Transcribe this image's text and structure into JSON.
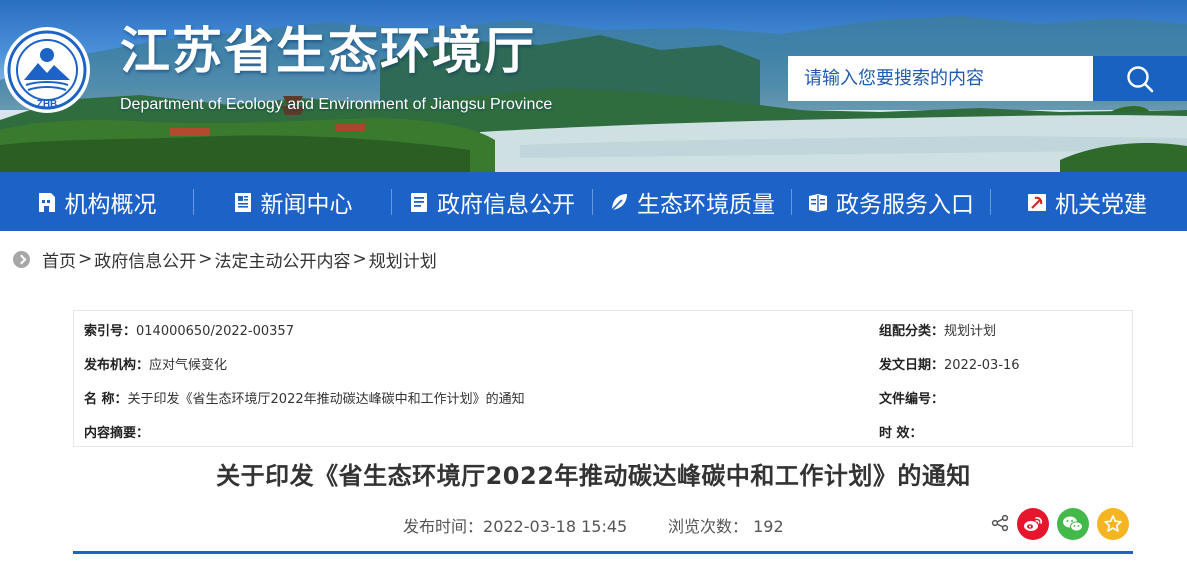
{
  "header": {
    "title": "江苏省生态环境厅",
    "subtitle": "Department of Ecology and Environment of Jiangsu Province",
    "logo_text": "ZHB",
    "search": {
      "placeholder": "请输入您要搜索的内容"
    },
    "colors": {
      "brand": "#1d62c6"
    }
  },
  "nav": {
    "items": [
      {
        "label": "机构概况",
        "icon": "building-icon"
      },
      {
        "label": "新闻中心",
        "icon": "news-icon"
      },
      {
        "label": "政府信息公开",
        "icon": "document-icon"
      },
      {
        "label": "生态环境质量",
        "icon": "leaf-icon"
      },
      {
        "label": "政务服务入口",
        "icon": "service-icon"
      },
      {
        "label": "机关党建",
        "icon": "party-icon"
      }
    ]
  },
  "breadcrumb": {
    "items": [
      "首页",
      "政府信息公开",
      "法定主动公开内容",
      "规划计划"
    ],
    "separator": ">"
  },
  "meta": {
    "index_label": "索引号：",
    "index_value": "014000650/2022-00357",
    "category_label": "组配分类：",
    "category_value": "规划计划",
    "publisher_label": "发布机构：",
    "publisher_value": "应对气候变化",
    "date_label": "发文日期：",
    "date_value": "2022-03-16",
    "name_label": "名 称：",
    "name_value": "关于印发《省生态环境厅2022年推动碳达峰碳中和工作计划》的通知",
    "docno_label": "文件编号：",
    "docno_value": "",
    "summary_label": "内容摘要：",
    "summary_value": "",
    "validity_label": "时 效：",
    "validity_value": ""
  },
  "article": {
    "title": "关于印发《省生态环境厅2022年推动碳达峰碳中和工作计划》的通知",
    "publish_label": "发布时间：",
    "publish_time": "2022-03-18 15:45",
    "views_label": "浏览次数：",
    "views": "192"
  },
  "share": {
    "icons": [
      "share-icon",
      "weibo-icon",
      "wechat-icon",
      "favorite-icon"
    ],
    "colors": {
      "weibo": "#e6162d",
      "wechat": "#43b94a",
      "favorite": "#f5b521"
    }
  }
}
